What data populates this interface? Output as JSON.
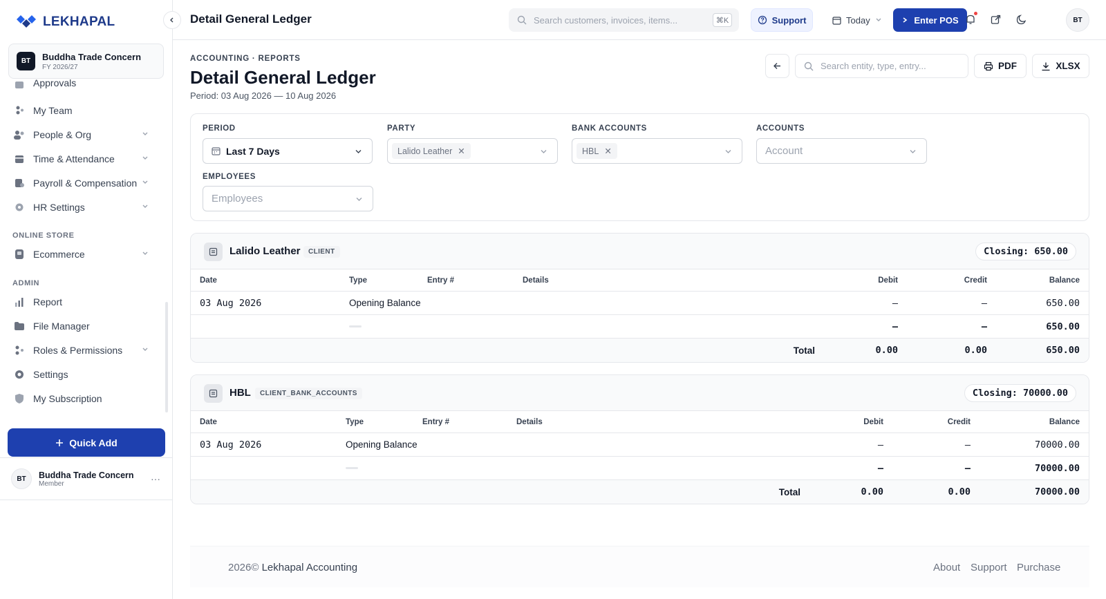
{
  "brand": {
    "name": "LEKHAPAL"
  },
  "org": {
    "initials": "BT",
    "name": "Buddha Trade Concern",
    "fy": "FY 2026/27"
  },
  "sidebar": {
    "items": [
      {
        "label": "Approvals"
      },
      {
        "label": "My Team"
      },
      {
        "label": "People & Org"
      },
      {
        "label": "Time & Attendance"
      },
      {
        "label": "Payroll & Compensation"
      },
      {
        "label": "HR Settings"
      },
      {
        "label": "Ecommerce"
      },
      {
        "label": "Report"
      },
      {
        "label": "File Manager"
      },
      {
        "label": "Roles & Permissions"
      },
      {
        "label": "Settings"
      },
      {
        "label": "My Subscription"
      }
    ],
    "sections": {
      "online_store": "ONLINE STORE",
      "admin": "ADMIN"
    },
    "quick_add": "Quick Add",
    "user": {
      "initials": "BT",
      "name": "Buddha Trade Concern",
      "role": "Member"
    }
  },
  "topbar": {
    "title": "Detail General Ledger",
    "search_placeholder": "Search customers, invoices, items...",
    "shortcut": "⌘K",
    "support": "Support",
    "date_filter": "Today",
    "enter_pos": "Enter POS",
    "avatar": "BT"
  },
  "page": {
    "breadcrumb": "ACCOUNTING · REPORTS",
    "title": "Detail General Ledger",
    "period": "Period: 03 Aug 2026 — 10 Aug 2026",
    "search_placeholder": "Search entity, type, entry...",
    "pdf": "PDF",
    "xlsx": "XLSX"
  },
  "filters": {
    "period": {
      "label": "PERIOD",
      "value": "Last 7 Days"
    },
    "party": {
      "label": "PARTY",
      "chip": "Lalido Leather"
    },
    "bank_accounts": {
      "label": "BANK ACCOUNTS",
      "chip": "HBL"
    },
    "accounts": {
      "label": "ACCOUNTS",
      "placeholder": "Account"
    },
    "employees": {
      "label": "EMPLOYEES",
      "placeholder": "Employees"
    }
  },
  "ledgers": [
    {
      "name": "Lalido Leather",
      "tag": "CLIENT",
      "closing": "Closing: 650.00",
      "columns": [
        "Date",
        "Type",
        "Entry #",
        "Details",
        "Debit",
        "Credit",
        "Balance"
      ],
      "rows": [
        {
          "date": "03 Aug 2026",
          "type": "Opening Balance",
          "debit": "–",
          "credit": "–",
          "balance": "650.00"
        },
        {
          "date": "",
          "type": "",
          "debit": "–",
          "credit": "–",
          "balance": "650.00"
        }
      ],
      "total": {
        "label": "Total",
        "debit": "0.00",
        "credit": "0.00",
        "balance": "650.00"
      }
    },
    {
      "name": "HBL",
      "tag": "CLIENT_BANK_ACCOUNTS",
      "closing": "Closing: 70000.00",
      "columns": [
        "Date",
        "Type",
        "Entry #",
        "Details",
        "Debit",
        "Credit",
        "Balance"
      ],
      "rows": [
        {
          "date": "03 Aug 2026",
          "type": "Opening Balance",
          "debit": "–",
          "credit": "–",
          "balance": "70000.00"
        },
        {
          "date": "",
          "type": "",
          "debit": "–",
          "credit": "–",
          "balance": "70000.00"
        }
      ],
      "total": {
        "label": "Total",
        "debit": "0.00",
        "credit": "0.00",
        "balance": "70000.00"
      }
    }
  ],
  "footer": {
    "year": "2026©",
    "company": "Lekhapal Accounting",
    "links": [
      "About",
      "Support",
      "Purchase"
    ]
  }
}
